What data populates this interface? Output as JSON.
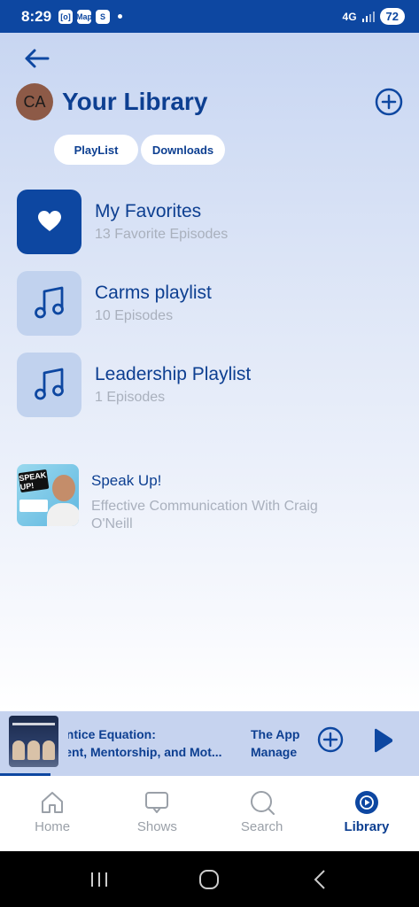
{
  "status_bar": {
    "time": "8:29",
    "app_icons": [
      "[o]",
      "Map",
      "S"
    ],
    "network": "4G",
    "battery": "72"
  },
  "header": {
    "avatar_initials": "CA",
    "title": "Your Library"
  },
  "tabs": [
    {
      "label": "PlayList"
    },
    {
      "label": "Downloads"
    }
  ],
  "library_items": [
    {
      "title": "My Favorites",
      "subtitle": "13 Favorite Episodes",
      "icon": "heart-icon"
    },
    {
      "title": "Carms playlist",
      "subtitle": "10 Episodes",
      "icon": "music-note-icon"
    },
    {
      "title": "Leadership Playlist",
      "subtitle": "1 Episodes",
      "icon": "music-note-icon"
    }
  ],
  "podcast": {
    "title": "Speak Up!",
    "subtitle": "Effective Communication With Craig O'Neill",
    "art_label": "SPEAK UP!"
  },
  "mini_player": {
    "line1_a": "prentice Equation:",
    "line2_a": "ement, Mentorship, and Mot...",
    "line1_b": "The App",
    "line2_b": "Manage",
    "progress_fraction": 0.12
  },
  "bottom_nav": [
    {
      "label": "Home",
      "icon": "home-icon",
      "active": false
    },
    {
      "label": "Shows",
      "icon": "shows-icon",
      "active": false
    },
    {
      "label": "Search",
      "icon": "search-icon",
      "active": false
    },
    {
      "label": "Library",
      "icon": "library-icon",
      "active": true
    }
  ],
  "colors": {
    "brand": "#0d47a1",
    "title_text": "#0d3f91",
    "subtitle_text": "#a9b0bd",
    "playlist_tile": "#c1d2ee"
  }
}
